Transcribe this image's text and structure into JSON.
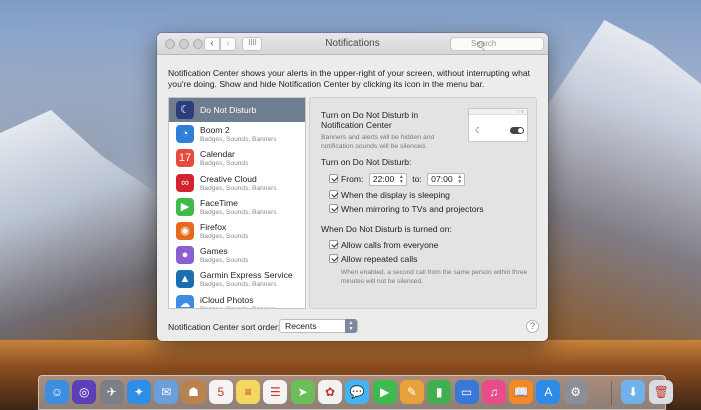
{
  "window": {
    "title": "Notifications",
    "search_placeholder": "Search",
    "intro": "Notification Center shows your alerts in the upper-right of your screen, without interrupting what you're doing. Show and hide Notification Center by clicking its icon in the menu bar."
  },
  "apps": [
    {
      "name": "Do Not Disturb",
      "sub": "",
      "icon": "moon-icon",
      "color": "#2b3e7a",
      "glyph": "☾"
    },
    {
      "name": "Boom 2",
      "sub": "Badges, Sounds, Banners",
      "icon": "boom-icon",
      "color": "#2f7ed8",
      "glyph": "◔"
    },
    {
      "name": "Calendar",
      "sub": "Badges, Sounds",
      "icon": "calendar-icon",
      "color": "#e84a3c",
      "glyph": "17"
    },
    {
      "name": "Creative Cloud",
      "sub": "Badges, Sounds, Banners",
      "icon": "creative-cloud-icon",
      "color": "#d4232e",
      "glyph": "∞"
    },
    {
      "name": "FaceTime",
      "sub": "Badges, Sounds, Banners",
      "icon": "facetime-icon",
      "color": "#3dbb4c",
      "glyph": "▶"
    },
    {
      "name": "Firefox",
      "sub": "Badges, Sounds",
      "icon": "firefox-icon",
      "color": "#e86a1f",
      "glyph": "◉"
    },
    {
      "name": "Games",
      "sub": "Badges, Sounds",
      "icon": "games-icon",
      "color": "#8c5fd0",
      "glyph": "●"
    },
    {
      "name": "Garmin Express Service",
      "sub": "Badges, Sounds, Banners",
      "icon": "garmin-icon",
      "color": "#1a6fb3",
      "glyph": "▲"
    },
    {
      "name": "iCloud Photos",
      "sub": "Badges, Sounds, Banners",
      "icon": "icloud-photos-icon",
      "color": "#3a8de3",
      "glyph": "☁"
    }
  ],
  "dnd": {
    "turn_on_label": "Turn on Do Not Disturb in Notification Center",
    "desc": "Banners and alerts will be hidden and notification sounds will be silenced.",
    "schedule_heading": "Turn on Do Not Disturb:",
    "from_label": "From:",
    "from_time": "22:00",
    "to_label": "to:",
    "to_time": "07:00",
    "display_sleeping": "When the display is sleeping",
    "mirroring": "When mirroring to TVs and projectors",
    "when_on_heading": "When Do Not Disturb is turned on:",
    "allow_calls": "Allow calls from everyone",
    "allow_repeated": "Allow repeated calls",
    "repeated_hint": "When enabled, a second call from the same person within three minutes will not be silenced."
  },
  "sort": {
    "label": "Notification Center sort order:",
    "value": "Recents"
  },
  "help_label": "?",
  "dock": [
    {
      "name": "finder-icon",
      "color": "#3b8fe0",
      "glyph": "☺"
    },
    {
      "name": "siri-icon",
      "color": "#5a3fb8",
      "glyph": "◎"
    },
    {
      "name": "launchpad-icon",
      "color": "#7a7f88",
      "glyph": "✈"
    },
    {
      "name": "safari-icon",
      "color": "#2e8de6",
      "glyph": "✦"
    },
    {
      "name": "mail-icon",
      "color": "#6a9fdc",
      "glyph": "✉"
    },
    {
      "name": "contacts-icon",
      "color": "#b9824e",
      "glyph": "☗"
    },
    {
      "name": "calendar-dock-icon",
      "color": "#f4f4f4",
      "glyph": "5"
    },
    {
      "name": "notes-icon",
      "color": "#f2d85e",
      "glyph": "≡"
    },
    {
      "name": "reminders-icon",
      "color": "#f4f4f4",
      "glyph": "☰"
    },
    {
      "name": "maps-icon",
      "color": "#6cbf58",
      "glyph": "➤"
    },
    {
      "name": "photos-icon",
      "color": "#f2f2f2",
      "glyph": "✿"
    },
    {
      "name": "messages-icon",
      "color": "#44b3f3",
      "glyph": "💬"
    },
    {
      "name": "facetime-dock-icon",
      "color": "#3dbb4c",
      "glyph": "▶"
    },
    {
      "name": "pages-icon",
      "color": "#e8a23a",
      "glyph": "✎"
    },
    {
      "name": "numbers-icon",
      "color": "#3fb04f",
      "glyph": "▮"
    },
    {
      "name": "keynote-icon",
      "color": "#3a78d8",
      "glyph": "▭"
    },
    {
      "name": "itunes-icon",
      "color": "#e84d8a",
      "glyph": "♫"
    },
    {
      "name": "ibooks-icon",
      "color": "#f08a24",
      "glyph": "📖"
    },
    {
      "name": "app-store-icon",
      "color": "#2d8ce8",
      "glyph": "A"
    },
    {
      "name": "system-preferences-icon",
      "color": "#8a8f97",
      "glyph": "⚙"
    },
    {
      "name": "downloads-folder-icon",
      "color": "#6fb2ea",
      "glyph": "⬇"
    },
    {
      "name": "trash-icon",
      "color": "#d8dde3",
      "glyph": "🗑"
    }
  ]
}
